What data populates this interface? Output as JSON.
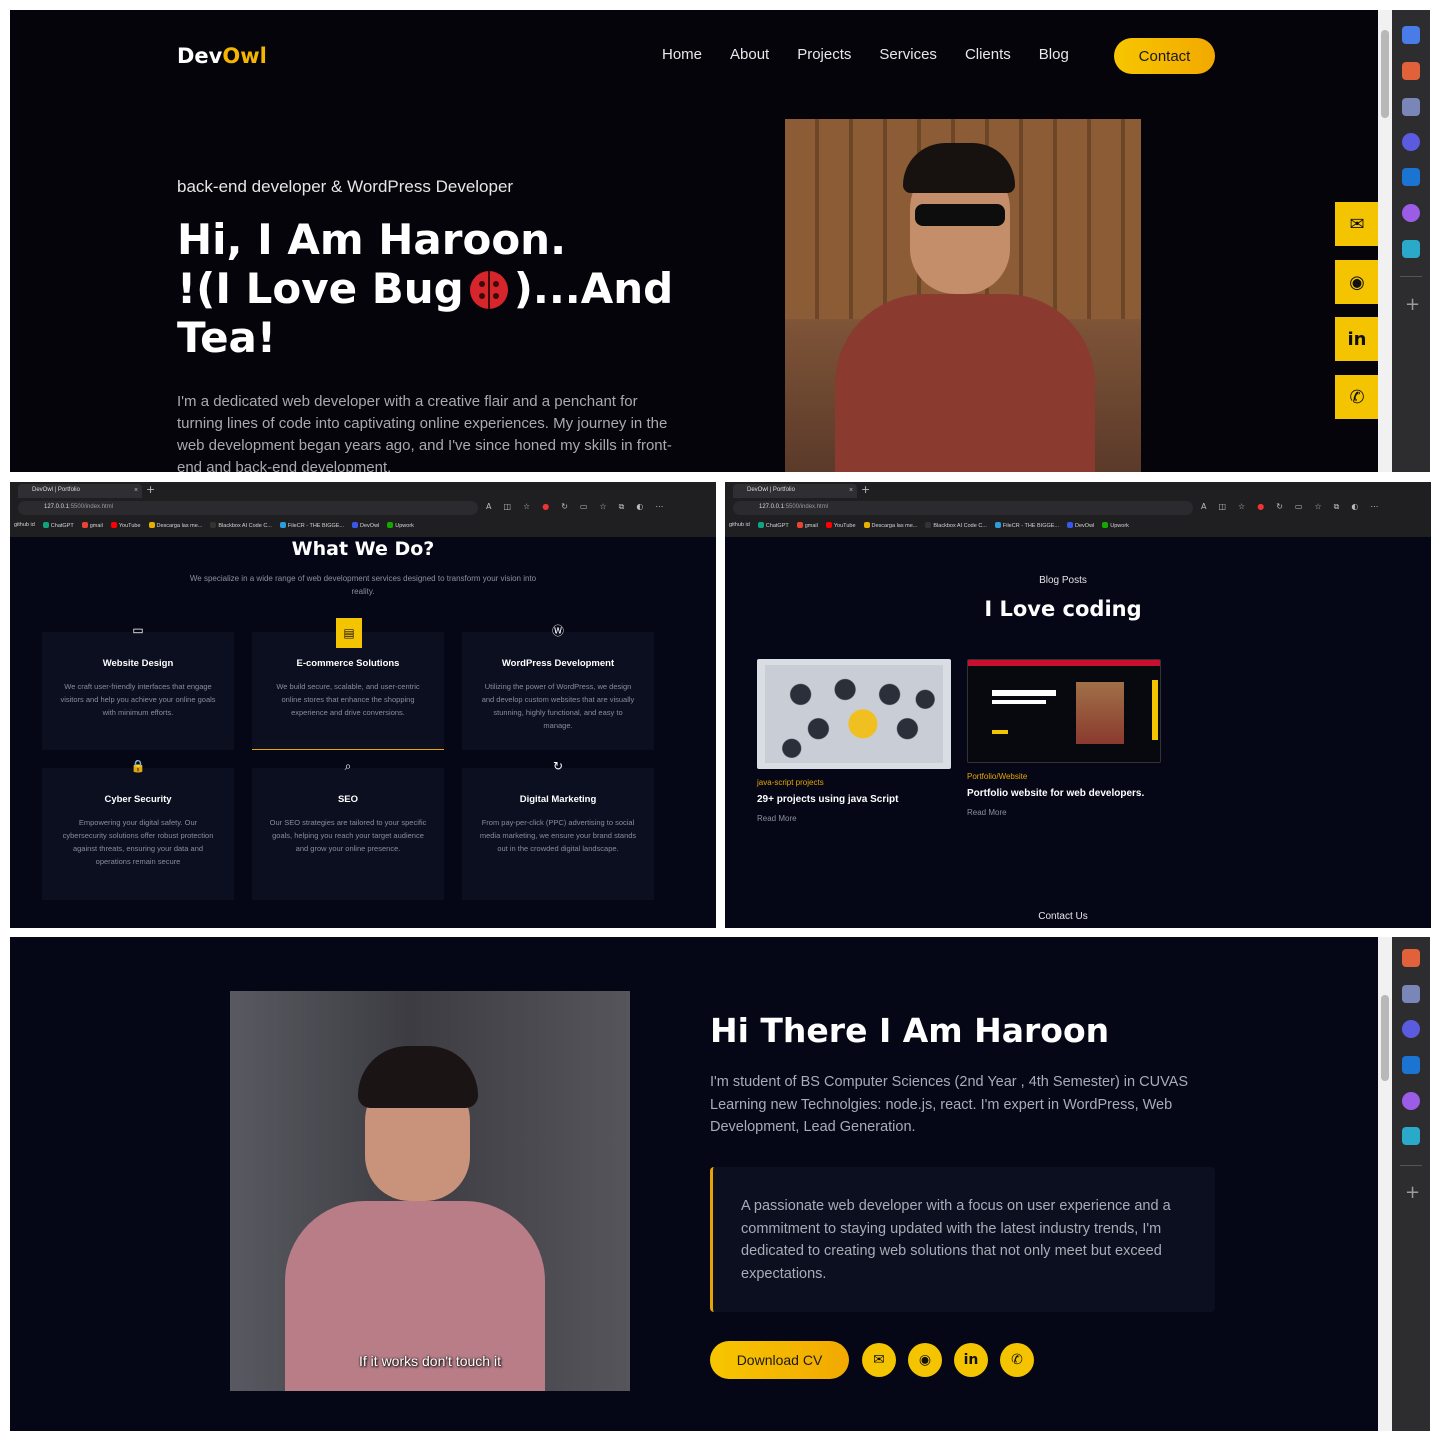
{
  "top": {
    "logo_main": "Dev",
    "logo_accent": "Owl",
    "nav": [
      "Home",
      "About",
      "Projects",
      "Services",
      "Clients",
      "Blog"
    ],
    "contact_label": "Contact",
    "tagline": "back-end developer & WordPress Developer",
    "hero_line1": "Hi, I Am Haroon.",
    "hero_line2a": "!(I Love Bug",
    "hero_line2b": ")...And",
    "hero_line3": "Tea!",
    "hero_desc": "I'm a dedicated web developer with a creative flair and a penchant for turning lines of code into captivating online experiences. My journey in the web development began years ago, and I've since honed my skills in front-end and back-end development.",
    "social_icons": [
      "mail-icon",
      "github-icon",
      "linkedin-icon",
      "whatsapp-icon"
    ],
    "social_glyphs": [
      "✉",
      "◉",
      "in",
      "✆"
    ]
  },
  "browser": {
    "tab_title": "DevOwl | Portfolio",
    "tab_close": "×",
    "new_tab": "+",
    "url_host": "127.0.0.1",
    "url_rest": ":5500/index.html",
    "bookmarks": [
      "github id",
      "ChatGPT",
      "gmail",
      "YouTube",
      "Descarga las me...",
      "Blackbox AI Code C...",
      "FileCR - THE BIGGE...",
      "DevOwl",
      "Upwork"
    ]
  },
  "services": {
    "title": "What We Do?",
    "subtitle": "We specialize in a wide range of web development services designed to transform your vision into reality.",
    "cards": [
      {
        "icon": "▭",
        "title": "Website Design",
        "text": "We craft user-friendly interfaces that engage visitors and help you achieve your online goals with minimum efforts."
      },
      {
        "icon": "▤",
        "title": "E-commerce Solutions",
        "text": "We build secure, scalable, and user-centric online stores that enhance the shopping experience and drive conversions."
      },
      {
        "icon": "Ⓦ",
        "title": "WordPress Development",
        "text": "Utilizing the power of WordPress, we design and develop custom websites that are visually stunning, highly functional, and easy to manage."
      },
      {
        "icon": "🔒",
        "title": "Cyber Security",
        "text": "Empowering your digital safety. Our cybersecurity solutions offer robust protection against threats, ensuring your data and operations remain secure"
      },
      {
        "icon": "⌕",
        "title": "SEO",
        "text": "Our SEO strategies are tailored to your specific goals, helping you reach your target audience and grow your online presence."
      },
      {
        "icon": "↻",
        "title": "Digital Marketing",
        "text": "From pay-per-click (PPC) advertising to social media marketing, we ensure your brand stands out in the crowded digital landscape."
      }
    ]
  },
  "blog": {
    "kicker": "Blog Posts",
    "title": "I Love coding",
    "posts": [
      {
        "category": "java-script projects",
        "title": "29+ projects using java Script",
        "more": "Read More"
      },
      {
        "category": "Portfolio/Website",
        "title": "Portfolio website for web developers.",
        "more": "Read More"
      }
    ],
    "contact_label": "Contact Us"
  },
  "about": {
    "photo_caption": "If it works don't touch it",
    "title": "Hi There I Am Haroon",
    "desc": "I'm student of BS Computer Sciences (2nd Year , 4th Semester) in CUVAS Learning new Technolgies: node.js, react. I'm expert in WordPress, Web Development, Lead Generation.",
    "quote": "A passionate web developer with a focus on user experience and a commitment to staying updated with the latest industry trends, I'm dedicated to creating web solutions that not only meet but exceed expectations.",
    "cv_label": "Download CV",
    "social_glyphs": [
      "✉",
      "◉",
      "in",
      "✆"
    ]
  },
  "colors": {
    "accent": "#f5c400",
    "bg_dark": "#04040a",
    "bg_navy": "#050717"
  }
}
